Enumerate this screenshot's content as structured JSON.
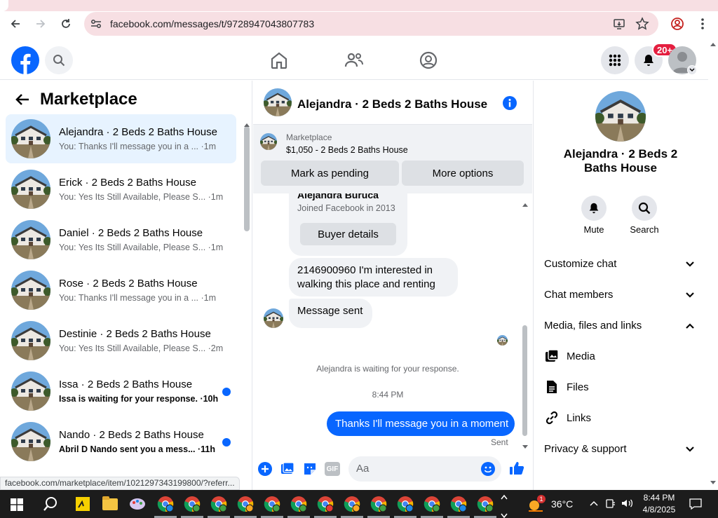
{
  "browser": {
    "url": "facebook.com/messages/t/9728947043807783",
    "status_url": "facebook.com/marketplace/item/1021297343199800/?referr..."
  },
  "header": {
    "notification_count": "20+"
  },
  "left": {
    "title": "Marketplace",
    "conversations": [
      {
        "name": "Alejandra · 2 Beds 2 Baths House",
        "preview": "You: Thanks I'll message you in a ... ·1m",
        "active": true,
        "unread": false
      },
      {
        "name": "Erick · 2 Beds 2 Baths House",
        "preview": "You: Yes Its Still Available, Please S... ·1m",
        "active": false,
        "unread": false
      },
      {
        "name": "Daniel · 2 Beds 2 Baths House",
        "preview": "You: Yes Its Still Available, Please S... ·1m",
        "active": false,
        "unread": false
      },
      {
        "name": "Rose · 2 Beds 2 Baths House",
        "preview": "You: Thanks I'll message you in a ... ·1m",
        "active": false,
        "unread": false
      },
      {
        "name": "Destinie · 2 Beds 2 Baths House",
        "preview": "You: Yes Its Still Available, Please S... ·2m",
        "active": false,
        "unread": false
      },
      {
        "name": "Issa · 2 Beds 2 Baths House",
        "preview": "Issa is waiting for your response. ·10h",
        "active": false,
        "unread": true
      },
      {
        "name": "Nando · 2 Beds 2 Baths House",
        "preview": "Abril D Nando sent you a mess... ·11h",
        "active": false,
        "unread": true
      }
    ]
  },
  "chat": {
    "title": "Alejandra · 2 Beds 2 Baths House",
    "marketplace_label": "Marketplace",
    "listing": "$1,050 - 2 Beds 2 Baths House",
    "mark_pending": "Mark as pending",
    "more_options": "More options",
    "buyer_name": "Alejandra Buruca",
    "joined": "Joined Facebook in 2013",
    "buyer_details": "Buyer details",
    "msg1_line1": "2146900960 I'm interested in",
    "msg1_line2": "walking this place and renting",
    "msg2": "Message sent",
    "waiting": "Alejandra is waiting for your response.",
    "time": "8:44 PM",
    "my_msg": "Thanks I'll message you in a moment",
    "sent": "Sent",
    "composer_placeholder": "Aa",
    "gif_label": "GIF"
  },
  "right": {
    "title_line1": "Alejandra · 2 Beds 2",
    "title_line2": "Baths House",
    "mute": "Mute",
    "search": "Search",
    "customize": "Customize chat",
    "members": "Chat members",
    "media_files": "Media, files and links",
    "media": "Media",
    "files": "Files",
    "links": "Links",
    "privacy": "Privacy & support"
  },
  "taskbar": {
    "weather": "36°C",
    "time": "8:44 PM",
    "date": "4/8/2025",
    "weather_badge": "1"
  },
  "colors": {
    "fb_blue": "#0866ff",
    "badge_red": "#e41e3f",
    "chrome_pink": "#f7dfe3"
  }
}
